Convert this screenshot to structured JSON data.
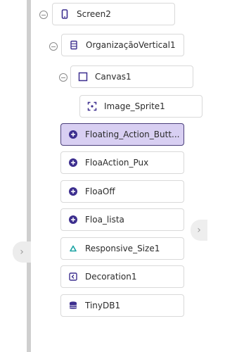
{
  "tree": {
    "nodes": [
      {
        "label": "Screen2",
        "icon": "phone-icon"
      },
      {
        "label": "OrganizaçãoVertical1",
        "icon": "vertical-arrangement-icon"
      },
      {
        "label": "Canvas1",
        "icon": "canvas-icon"
      },
      {
        "label": "Image_Sprite1",
        "icon": "sprite-icon"
      },
      {
        "label": "Floating_Action_Butt...",
        "icon": "plus-circle-icon",
        "selected": true
      },
      {
        "label": "FloaAction_Pux",
        "icon": "plus-circle-icon"
      },
      {
        "label": "FloaOff",
        "icon": "plus-circle-icon"
      },
      {
        "label": "Floa_lista",
        "icon": "plus-circle-icon"
      },
      {
        "label": "Responsive_Size1",
        "icon": "triangle-icon"
      },
      {
        "label": "Decoration1",
        "icon": "decoration-icon"
      },
      {
        "label": "TinyDB1",
        "icon": "database-icon"
      }
    ]
  },
  "colors": {
    "accent": "#4a3f7a",
    "selected_bg": "#d8cff2",
    "icon_purple": "#3d2f8f",
    "triangle_teal": "#1aa3a3"
  }
}
